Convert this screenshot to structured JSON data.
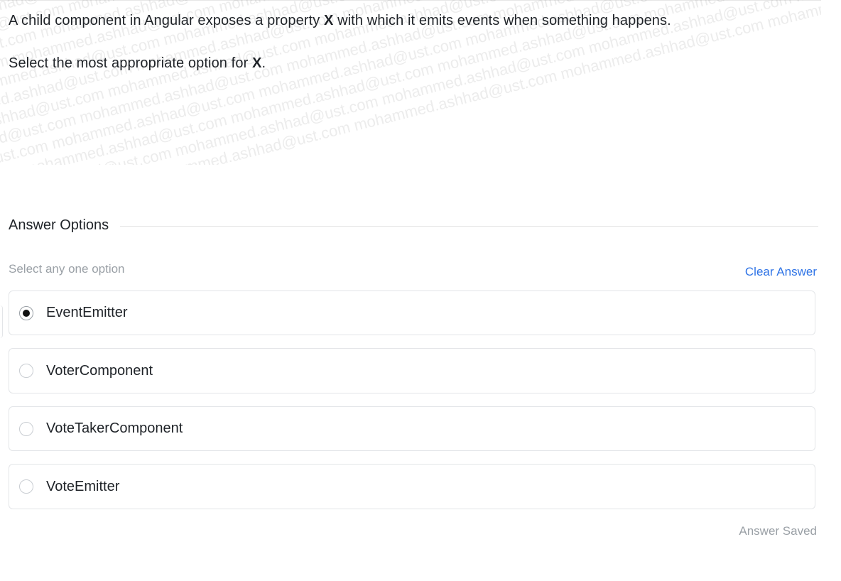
{
  "question": {
    "line1_before": "A child component in Angular exposes a property ",
    "line1_bold": "X",
    "line1_after": " with which it emits events when something happens.",
    "line2_before": "Select the most appropriate option for ",
    "line2_bold": "X",
    "line2_after": ".",
    "watermark_text": "mohammed.ashhad@ust.com"
  },
  "answers": {
    "section_title": "Answer Options",
    "hint": "Select any one option",
    "clear_label": "Clear Answer",
    "options": [
      {
        "label": "EventEmitter",
        "selected": true
      },
      {
        "label": "VoterComponent",
        "selected": false
      },
      {
        "label": "VoteTakerComponent",
        "selected": false
      },
      {
        "label": "VoteEmitter",
        "selected": false
      }
    ],
    "status": "Answer Saved"
  }
}
